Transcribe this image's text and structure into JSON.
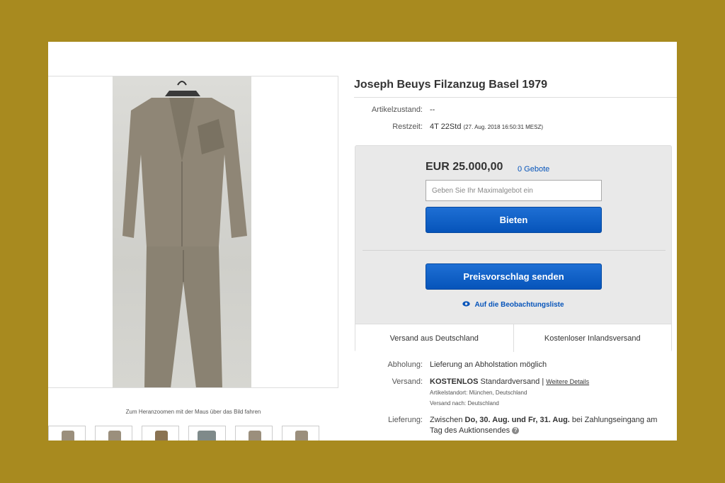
{
  "listing": {
    "title": "Joseph Beuys Filzanzug Basel 1979",
    "condition_label": "Artikelzustand:",
    "condition_value": "--",
    "time_label": "Restzeit:",
    "time_value": "4T 22Std",
    "time_end": "(27. Aug. 2018   16:50:31 MESZ)"
  },
  "gallery": {
    "zoom_hint": "Zum Heranzoomen mit der Maus über das Bild fahren"
  },
  "buybox": {
    "price": "EUR 25.000,00",
    "bids": "0 Gebote",
    "bid_placeholder": "Geben Sie Ihr Maximalgebot ein",
    "bid_button": "Bieten",
    "offer_button": "Preisvorschlag senden",
    "watch_link": "Auf die Beobachtungsliste",
    "ship_from": "Versand aus Deutschland",
    "ship_free": "Kostenloser Inlandsversand"
  },
  "details": {
    "pickup_label": "Abholung:",
    "pickup_value": "Lieferung an Abholstation möglich",
    "shipping_label": "Versand:",
    "shipping_free": "KOSTENLOS",
    "shipping_type": "Standardversand",
    "shipping_more": "Weitere Details",
    "item_location": "Artikelstandort:  München, Deutschland",
    "ships_to": "Versand nach:  Deutschland",
    "delivery_label": "Lieferung:",
    "delivery_pre": "Zwischen ",
    "delivery_dates": "Do, 30. Aug. und Fr, 31. Aug.",
    "delivery_post": " bei Zahlungseingang am",
    "delivery_line2": "Tag des Auktionsendes"
  },
  "colors": {
    "background": "#a88a1f",
    "link_blue": "#0654ba",
    "button_blue": "#0654ba"
  }
}
